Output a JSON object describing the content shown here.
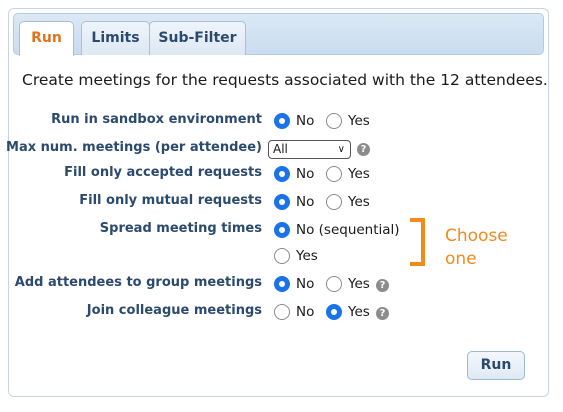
{
  "tabs": [
    {
      "label": "Run",
      "active": true
    },
    {
      "label": "Limits",
      "active": false
    },
    {
      "label": "Sub-Filter",
      "active": false
    }
  ],
  "intro_text": "Create meetings for the requests associated with the 12 attendees.",
  "form": {
    "sandbox": {
      "label": "Run in sandbox environment",
      "options": [
        "No",
        "Yes"
      ],
      "selected": "No"
    },
    "max_meetings": {
      "label": "Max num. meetings (per attendee)",
      "value": "All"
    },
    "accepted": {
      "label": "Fill only accepted requests",
      "options": [
        "No",
        "Yes"
      ],
      "selected": "No"
    },
    "mutual": {
      "label": "Fill only mutual requests",
      "options": [
        "No",
        "Yes"
      ],
      "selected": "No"
    },
    "spread": {
      "label": "Spread meeting times",
      "options": [
        "No (sequential)",
        "Yes"
      ],
      "selected": "No (sequential)"
    },
    "group": {
      "label": "Add attendees to group meetings",
      "options": [
        "No",
        "Yes"
      ],
      "selected": "No"
    },
    "colleague": {
      "label": "Join colleague meetings",
      "options": [
        "No",
        "Yes"
      ],
      "selected": "Yes"
    }
  },
  "annotation": {
    "line1": "Choose",
    "line2": "one"
  },
  "run_button": "Run",
  "help_icon": "?",
  "colors": {
    "accent": "#1a73e8",
    "annotation": "#f28a1c",
    "label": "#2c4a6e",
    "active_tab": "#e0731c"
  }
}
